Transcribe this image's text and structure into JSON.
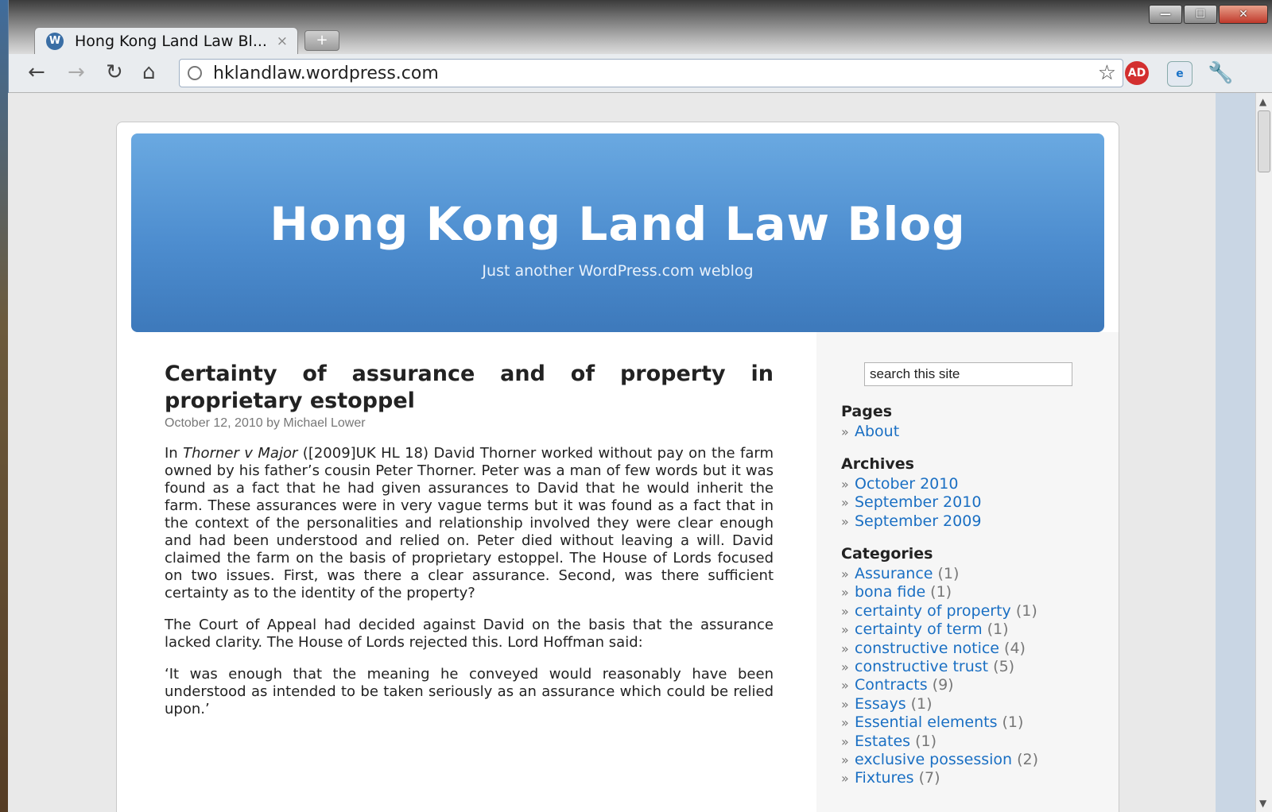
{
  "browser": {
    "tab_title": "Hong Kong Land Law Bl...",
    "tab_close": "×",
    "new_tab": "+",
    "url": "hklandlaw.wordpress.com",
    "controls": {
      "minimize": "—",
      "maximize": "☐",
      "close": "✕"
    },
    "icons": {
      "back": "back-arrow-icon",
      "forward": "forward-arrow-icon",
      "reload": "reload-icon",
      "home": "home-icon",
      "star": "star-icon",
      "wrench": "wrench-icon"
    }
  },
  "blog": {
    "title": "Hong Kong Land Law Blog",
    "tagline": "Just another WordPress.com weblog"
  },
  "post": {
    "title": "Certainty of assurance and of property in proprietary estoppel",
    "meta": "October 12, 2010 by Michael Lower",
    "p1_lead": "In ",
    "p1_case": "Thorner v Major",
    "p1_rest": " ([2009]UK HL 18) David Thorner worked without pay on the farm owned by his father’s cousin Peter Thorner. Peter was a man of few words but it was found as a fact that he had given assurances to David that he would inherit the farm. These assurances were in very vague terms but it was found as a fact that in the context of the personalities and relationship involved they were clear enough and had been understood and relied on. Peter died without leaving a will. David claimed the farm on the basis of proprietary estoppel. The House of Lords focused on two issues. First, was there a clear assurance. Second, was there sufficient certainty as to the identity of the property?",
    "p2": "The Court of Appeal had decided against David on the basis that the assurance lacked clarity. The House of Lords rejected this.  Lord Hoffman said:",
    "p3": "‘It was enough that the meaning he conveyed would reasonably have been understood as intended to be taken seriously as an assurance which could be relied upon.’"
  },
  "sidebar": {
    "search_value": "search this site",
    "pages_heading": "Pages",
    "pages": [
      {
        "label": "About"
      }
    ],
    "archives_heading": "Archives",
    "archives": [
      {
        "label": "October 2010"
      },
      {
        "label": "September 2010"
      },
      {
        "label": "September 2009"
      }
    ],
    "categories_heading": "Categories",
    "categories": [
      {
        "label": "Assurance",
        "count": "(1)"
      },
      {
        "label": "bona fide",
        "count": "(1)"
      },
      {
        "label": "certainty of property",
        "count": "(1)"
      },
      {
        "label": "certainty of term",
        "count": "(1)"
      },
      {
        "label": "constructive notice",
        "count": "(4)"
      },
      {
        "label": "constructive trust",
        "count": "(5)"
      },
      {
        "label": "Contracts",
        "count": "(9)"
      },
      {
        "label": "Essays",
        "count": "(1)"
      },
      {
        "label": "Essential elements",
        "count": "(1)"
      },
      {
        "label": "Estates",
        "count": "(1)"
      },
      {
        "label": "exclusive possession",
        "count": "(2)"
      },
      {
        "label": "Fixtures",
        "count": "(7)"
      }
    ]
  },
  "colors": {
    "link": "#1a6fc3",
    "header_top": "#6aa9e1",
    "header_bottom": "#3d79bb"
  }
}
